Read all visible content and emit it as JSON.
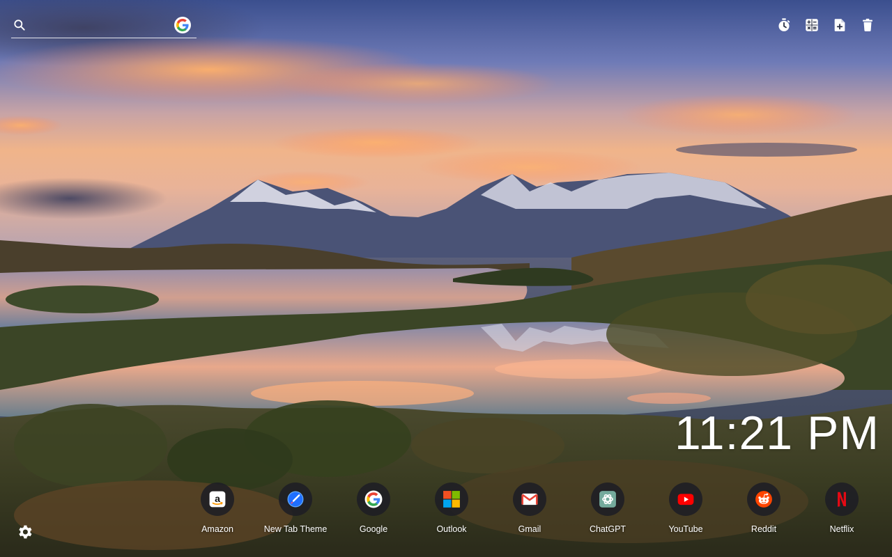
{
  "search": {
    "placeholder": "",
    "value": "",
    "engine": "Google"
  },
  "toolbar": {
    "items": [
      {
        "name": "timer",
        "icon": "stopwatch-icon"
      },
      {
        "name": "calculator",
        "icon": "calculator-icon"
      },
      {
        "name": "add-note",
        "icon": "note-add-icon"
      },
      {
        "name": "trash",
        "icon": "trash-icon"
      }
    ]
  },
  "clock": {
    "time": "11:21 PM"
  },
  "shortcuts": [
    {
      "label": "Amazon",
      "icon": "amazon-icon"
    },
    {
      "label": "New Tab Theme",
      "icon": "new-tab-theme-icon"
    },
    {
      "label": "Google",
      "icon": "google-icon"
    },
    {
      "label": "Outlook",
      "icon": "microsoft-icon"
    },
    {
      "label": "Gmail",
      "icon": "gmail-icon"
    },
    {
      "label": "ChatGPT",
      "icon": "chatgpt-icon"
    },
    {
      "label": "YouTube",
      "icon": "youtube-icon"
    },
    {
      "label": "Reddit",
      "icon": "reddit-icon"
    },
    {
      "label": "Netflix",
      "icon": "netflix-icon"
    }
  ],
  "colors": {
    "text": "#ffffff",
    "shortcut_bg": "#1e1e24",
    "youtube": "#ff0000",
    "netflix": "#e50914",
    "reddit": "#ff4500",
    "gmail": "#ea4335",
    "chatgpt": "#74aa9c"
  },
  "background": {
    "description_icon": "mountain-lake-sunset-wallpaper"
  }
}
